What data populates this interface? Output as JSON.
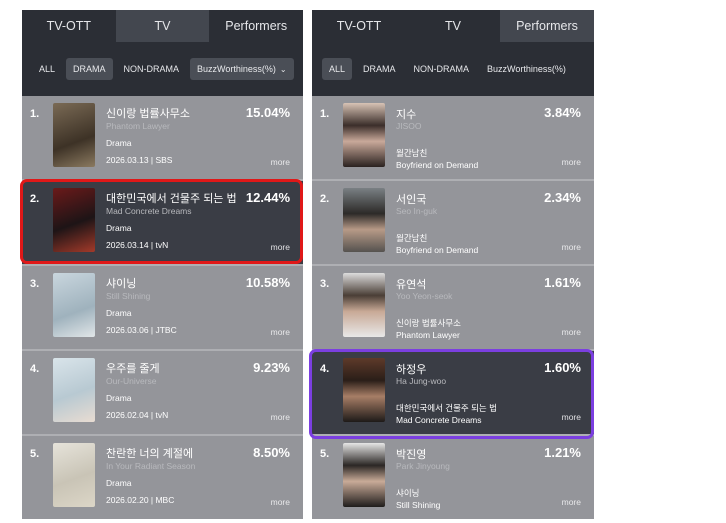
{
  "left": {
    "tabs": [
      "TV-OTT",
      "TV",
      "Performers"
    ],
    "active_tab": "TV",
    "filters": [
      "ALL",
      "DRAMA",
      "NON-DRAMA"
    ],
    "active_filter": "DRAMA",
    "dropdown_label": "BuzzWorthiness(%)",
    "items": [
      {
        "rank": "1.",
        "title": "신이랑 법률사무소",
        "subtitle": "Phantom Lawyer",
        "genre": "Drama",
        "meta": "2026.03.13 | SBS",
        "percent": "15.04%",
        "more": "more"
      },
      {
        "rank": "2.",
        "title": "대한민국에서 건물주 되는 법",
        "subtitle": "Mad Concrete Dreams",
        "genre": "Drama",
        "meta": "2026.03.14 | tvN",
        "percent": "12.44%",
        "more": "more"
      },
      {
        "rank": "3.",
        "title": "샤이닝",
        "subtitle": "Still Shining",
        "genre": "Drama",
        "meta": "2026.03.06 | JTBC",
        "percent": "10.58%",
        "more": "more"
      },
      {
        "rank": "4.",
        "title": "우주를 줄게",
        "subtitle": "Our-Universe",
        "genre": "Drama",
        "meta": "2026.02.04 | tvN",
        "percent": "9.23%",
        "more": "more"
      },
      {
        "rank": "5.",
        "title": "찬란한 너의 계절에",
        "subtitle": "In Your Radiant Season",
        "genre": "Drama",
        "meta": "2026.02.20 | MBC",
        "percent": "8.50%",
        "more": "more"
      }
    ]
  },
  "right": {
    "tabs": [
      "TV-OTT",
      "TV",
      "Performers"
    ],
    "active_tab": "Performers",
    "filters": [
      "ALL",
      "DRAMA",
      "NON-DRAMA",
      "BuzzWorthiness(%)"
    ],
    "active_filter": "ALL",
    "items": [
      {
        "rank": "1.",
        "name": "지수",
        "name_en": "JISOO",
        "work": "월간남친",
        "work_en": "Boyfriend on Demand",
        "percent": "3.84%",
        "more": "more"
      },
      {
        "rank": "2.",
        "name": "서인국",
        "name_en": "Seo In-guk",
        "work": "월간남친",
        "work_en": "Boyfriend on Demand",
        "percent": "2.34%",
        "more": "more"
      },
      {
        "rank": "3.",
        "name": "유연석",
        "name_en": "Yoo Yeon-seok",
        "work": "신이랑 법률사무소",
        "work_en": "Phantom Lawyer",
        "percent": "1.61%",
        "more": "more"
      },
      {
        "rank": "4.",
        "name": "하정우",
        "name_en": "Ha Jung-woo",
        "work": "대한민국에서 건물주 되는 법",
        "work_en": "Mad Concrete Dreams",
        "percent": "1.60%",
        "more": "more"
      },
      {
        "rank": "5.",
        "name": "박진영",
        "name_en": "Park Jinyoung",
        "work": "샤이닝",
        "work_en": "Still Shining",
        "percent": "1.21%",
        "more": "more"
      }
    ]
  },
  "colors": {
    "header_bg": "#2b2e35",
    "list_bg": "#94959a",
    "highlight_bg": "#3a3d45",
    "red_box": "#e01818",
    "purple_box": "#7b3fe0"
  }
}
